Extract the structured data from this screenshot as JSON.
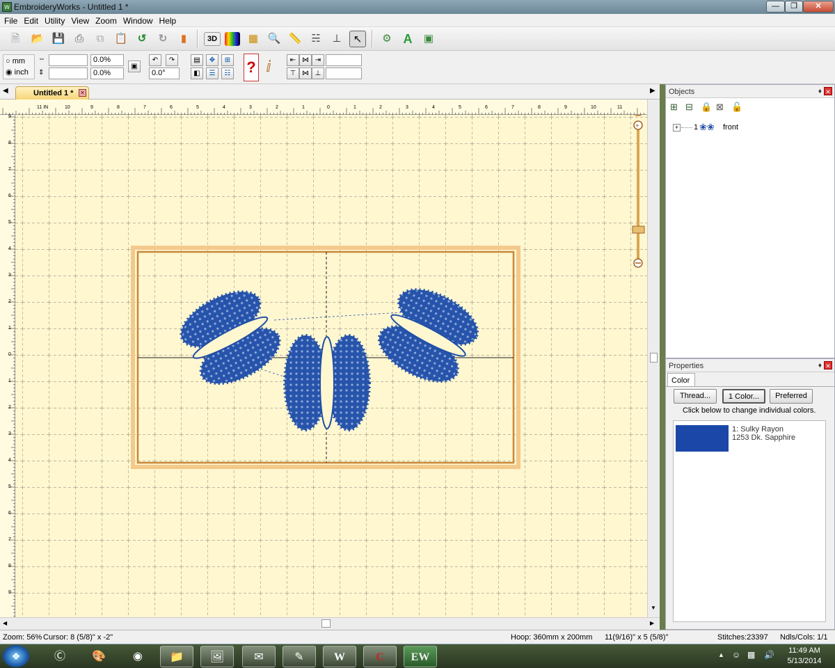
{
  "window": {
    "title": "EmbroideryWorks -  Untitled 1 *",
    "app_icon_text": "W"
  },
  "menu": [
    "File",
    "Edit",
    "Utility",
    "View",
    "Zoom",
    "Window",
    "Help"
  ],
  "toolbar_2d": {
    "unit_mm": "mm",
    "unit_inch": "inch",
    "width_value": "",
    "height_value": "",
    "width_pct": "0.0%",
    "height_pct": "0.0%",
    "rotation": "0.0°",
    "toolbar_3d_label": "3D"
  },
  "document_tab": {
    "label": "Untitled 1 *"
  },
  "ruler": {
    "h_labels": [
      "11 IN",
      "10",
      "9",
      "8",
      "7",
      "6",
      "5",
      "4",
      "3",
      "2",
      "1",
      "0",
      "1",
      "2",
      "3",
      "4",
      "5",
      "6",
      "7",
      "8",
      "9",
      "10",
      "11"
    ],
    "v_labels": [
      "9",
      "8",
      "7",
      "6",
      "5",
      "4",
      "3",
      "2",
      "1",
      "0",
      "1",
      "2",
      "3",
      "4",
      "5",
      "6",
      "7",
      "8",
      "9"
    ],
    "compass": "N"
  },
  "objects_panel": {
    "title": "Objects",
    "item_index": "1",
    "item_name": "front"
  },
  "properties_panel": {
    "title": "Properties",
    "tab": "Color",
    "buttons": [
      "Thread...",
      "1 Color...",
      "Preferred"
    ],
    "hint": "Click below to change individual colors.",
    "thread_line1": "1: Sulky Rayon",
    "thread_line2": "1253 Dk. Sapphire",
    "swatch_color": "#1a47a8"
  },
  "design": {
    "thread_color": "#1f4ea6",
    "hoop_border_color": "#c9873a"
  },
  "status": {
    "zoom": "Zoom: 56%",
    "cursor": "Cursor: 8 (5/8)\" x -2\"",
    "hoop": "Hoop: 360mm x 200mm",
    "size": "11(9/16)\" x 5 (5/8)\"",
    "stitches": "Stitches:23397",
    "ndls": "Ndls/Cols: 1/1"
  },
  "tray": {
    "time": "11:49 AM",
    "date": "5/13/2014"
  }
}
